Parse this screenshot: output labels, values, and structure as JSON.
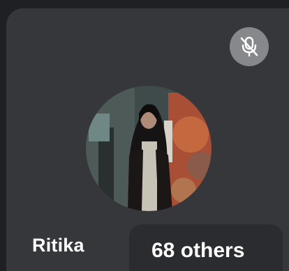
{
  "participant": {
    "name": "Ritika",
    "avatar_icon": "participant-photo",
    "mic_status_icon": "mic-muted-icon"
  },
  "others": {
    "label": "68 others"
  },
  "colors": {
    "tile_background": "#36373b",
    "mute_badge": "#87888b",
    "pill_background": "#2b2c2f",
    "text": "#ffffff"
  }
}
